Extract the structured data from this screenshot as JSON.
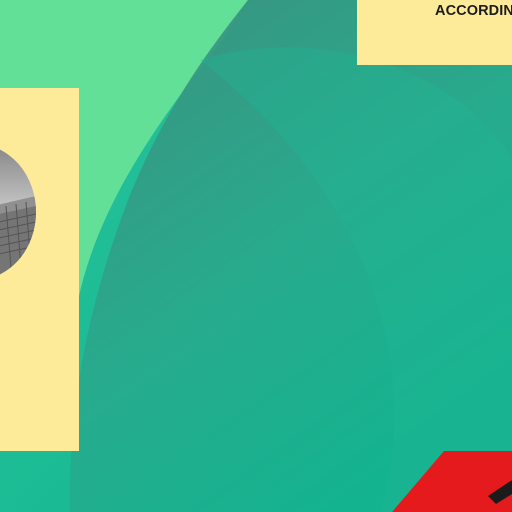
{
  "slide": {
    "heading": "ACCORDING"
  },
  "colors": {
    "background": "#11b693",
    "light_green": "#63e097",
    "dark_wedge": "#3e8f7c",
    "card_yellow": "#fdeb99",
    "accent_red": "#e51a1c",
    "text_dark": "#1b1b1b"
  },
  "image": {
    "type": "grayscale-photo",
    "subject": "architecture"
  }
}
